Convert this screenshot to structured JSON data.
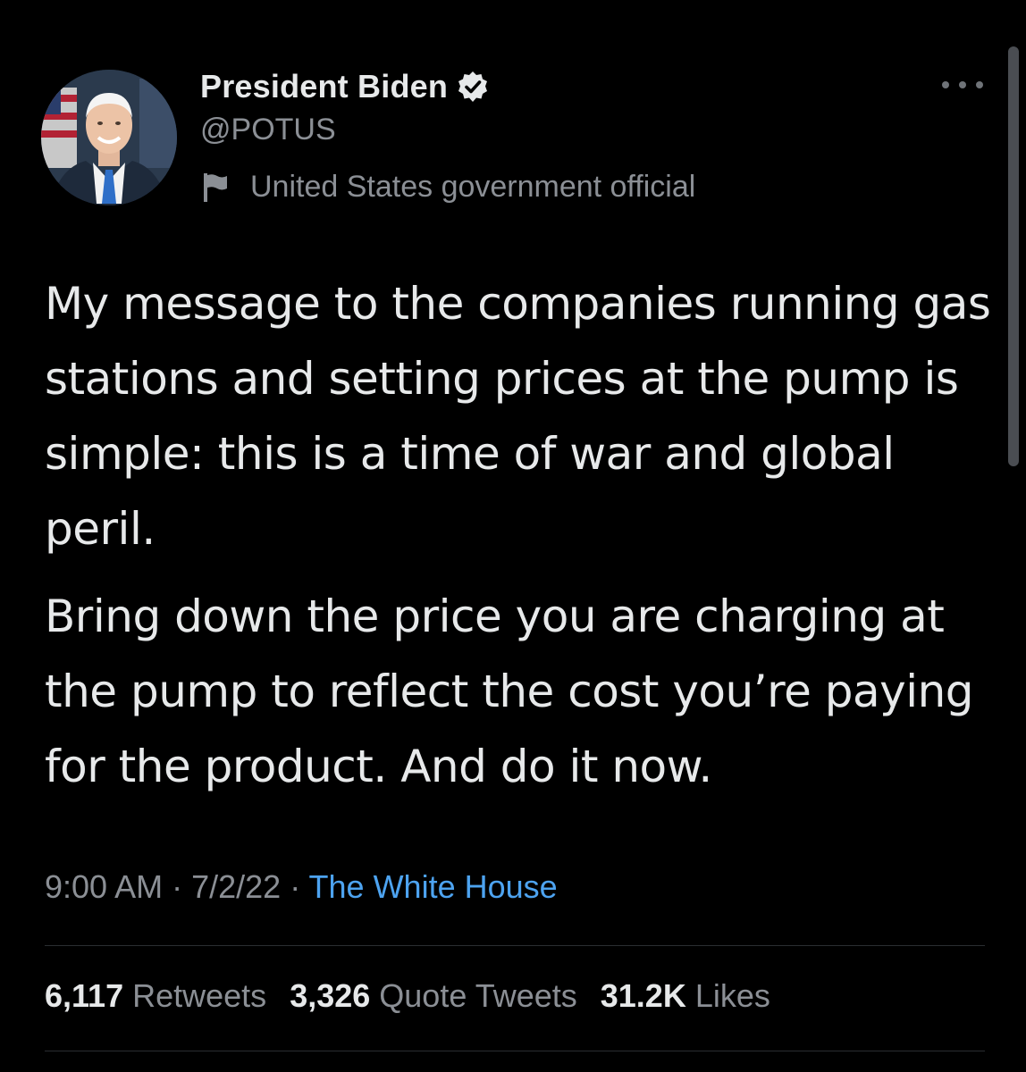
{
  "author": {
    "display_name": "President Biden",
    "handle": "@POTUS",
    "label": "United States government official",
    "avatar_icon": "portrait-photo",
    "verified_icon": "verified-badge-icon"
  },
  "tweet": {
    "paragraphs": [
      "My message to the companies running gas stations and setting prices at the pump is simple: this is a time of war and global peril.",
      "Bring down the price you are charging at the pump to reflect the cost you’re paying for the product. And do it now."
    ],
    "time": "9:00 AM",
    "date": "7/2/22",
    "separator": " · ",
    "source": "The White House"
  },
  "stats": {
    "retweets_count": "6,117",
    "retweets_label": "Retweets",
    "quotes_count": "3,326",
    "quotes_label": "Quote Tweets",
    "likes_count": "31.2K",
    "likes_label": "Likes"
  },
  "colors": {
    "background": "#000000",
    "text": "#e7e9ea",
    "secondary": "#8b8f95",
    "link": "#4da3f0"
  }
}
